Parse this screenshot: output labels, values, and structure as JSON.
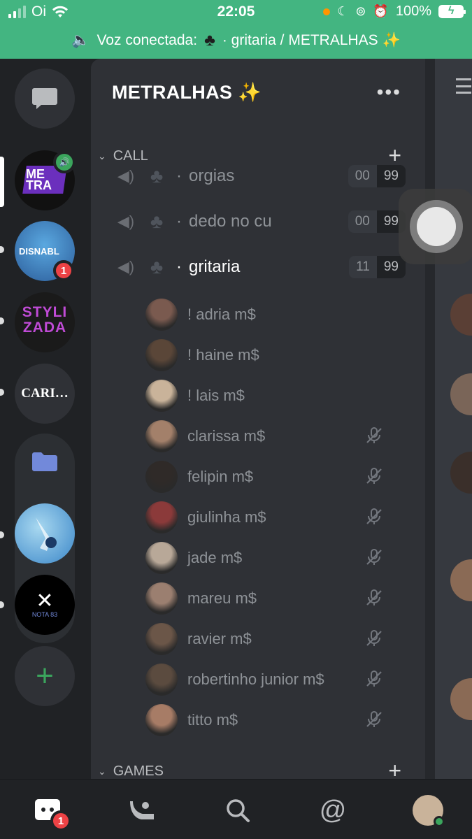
{
  "status_bar": {
    "carrier": "Oi",
    "time": "22:05",
    "battery": "100%"
  },
  "voice_banner": {
    "prefix": "Voz conectada:",
    "emoji": "♣",
    "channel": "· gritaria / METRALHAS ✨"
  },
  "server": {
    "title": "METRALHAS ✨",
    "menu_label": "•••"
  },
  "servers": [
    {
      "name": "ME TRA",
      "selected": true,
      "speaking": true
    },
    {
      "name": "DISNABL",
      "badge": "1"
    },
    {
      "name": "STYLIZADA"
    },
    {
      "name": "CARI…"
    },
    {
      "name": "folder"
    },
    {
      "name": "blue-server"
    },
    {
      "name": "NOTA 83"
    }
  ],
  "categories": {
    "call": "CALL",
    "games": "GAMES",
    "add": "+"
  },
  "channels": [
    {
      "name": "orgias",
      "count": "00",
      "limit": "99",
      "active": false
    },
    {
      "name": "dedo no cu",
      "count": "00",
      "limit": "99",
      "active": false
    },
    {
      "name": "gritaria",
      "count": "11",
      "limit": "99",
      "active": true
    }
  ],
  "channel_prefix": "·",
  "users": [
    {
      "name": "! adria m$",
      "muted": false,
      "color": "#7a5a4f"
    },
    {
      "name": "! haine m$",
      "muted": false,
      "color": "#5a4638"
    },
    {
      "name": "! lais m$",
      "muted": false,
      "color": "#c9b39a"
    },
    {
      "name": "clarissa m$",
      "muted": true,
      "color": "#a3806a"
    },
    {
      "name": "felipin m$",
      "muted": true,
      "color": "#2f2a28"
    },
    {
      "name": "giulinha m$",
      "muted": true,
      "color": "#8b3a3a"
    },
    {
      "name": "jade m$",
      "muted": true,
      "color": "#b8a898"
    },
    {
      "name": "mareu m$",
      "muted": true,
      "color": "#9b7f70"
    },
    {
      "name": "ravier m$",
      "muted": true,
      "color": "#6b5648"
    },
    {
      "name": "robertinho junior m$",
      "muted": true,
      "color": "#5b4b3f"
    },
    {
      "name": "titto m$",
      "muted": true,
      "color": "#a77c66"
    }
  ],
  "bottom_nav": {
    "home_badge": "1"
  },
  "colors": {
    "status_green": "#43b581",
    "panel": "#2f3136",
    "rail": "#202225",
    "danger": "#ed4245",
    "online": "#3ba55d"
  }
}
